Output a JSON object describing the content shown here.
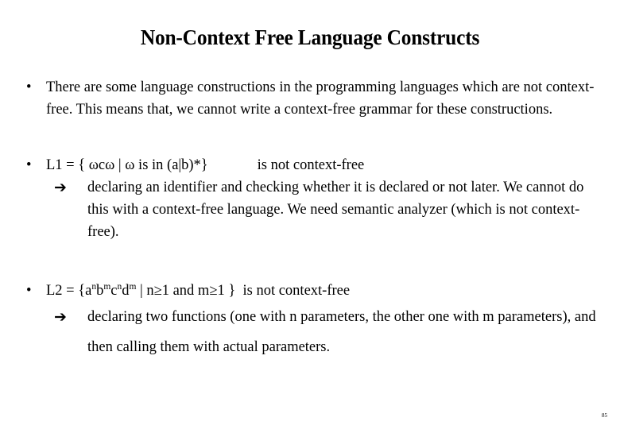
{
  "slide": {
    "title": "Non-Context Free Language Constructs",
    "page_number": "85",
    "background_color": "#ffffff",
    "text_color": "#000000",
    "bullet_glyph": "•",
    "arrow_glyph": "➔"
  },
  "blocks": [
    {
      "marker": "•",
      "text": "There are some language constructions in the programming languages which are not context-free. This means that, we cannot write a context-free grammar for these constructions."
    },
    {
      "marker": "•",
      "definition": "L1 = { ωcω | ω is in (a|b)*}",
      "note": "is not context-free",
      "sub": {
        "arrow": "➔",
        "text": "declaring an identifier and checking whether it is declared or not later. We cannot do this with a context-free language. We need semantic analyzer (which is not context-free)."
      }
    },
    {
      "marker": "•",
      "definition_parts": {
        "lead": "L2 = {a",
        "sup1": "n",
        "b": "b",
        "sup2": "m",
        "c": "c",
        "sup3": "n",
        "d": "d",
        "sup4": "m",
        "tail": " | n≥1 and m≥1 }"
      },
      "note": "is not context-free",
      "sub": {
        "arrow": "➔",
        "text": "declaring two functions (one with n parameters, the other one with m parameters), and then calling them with actual parameters."
      }
    }
  ]
}
